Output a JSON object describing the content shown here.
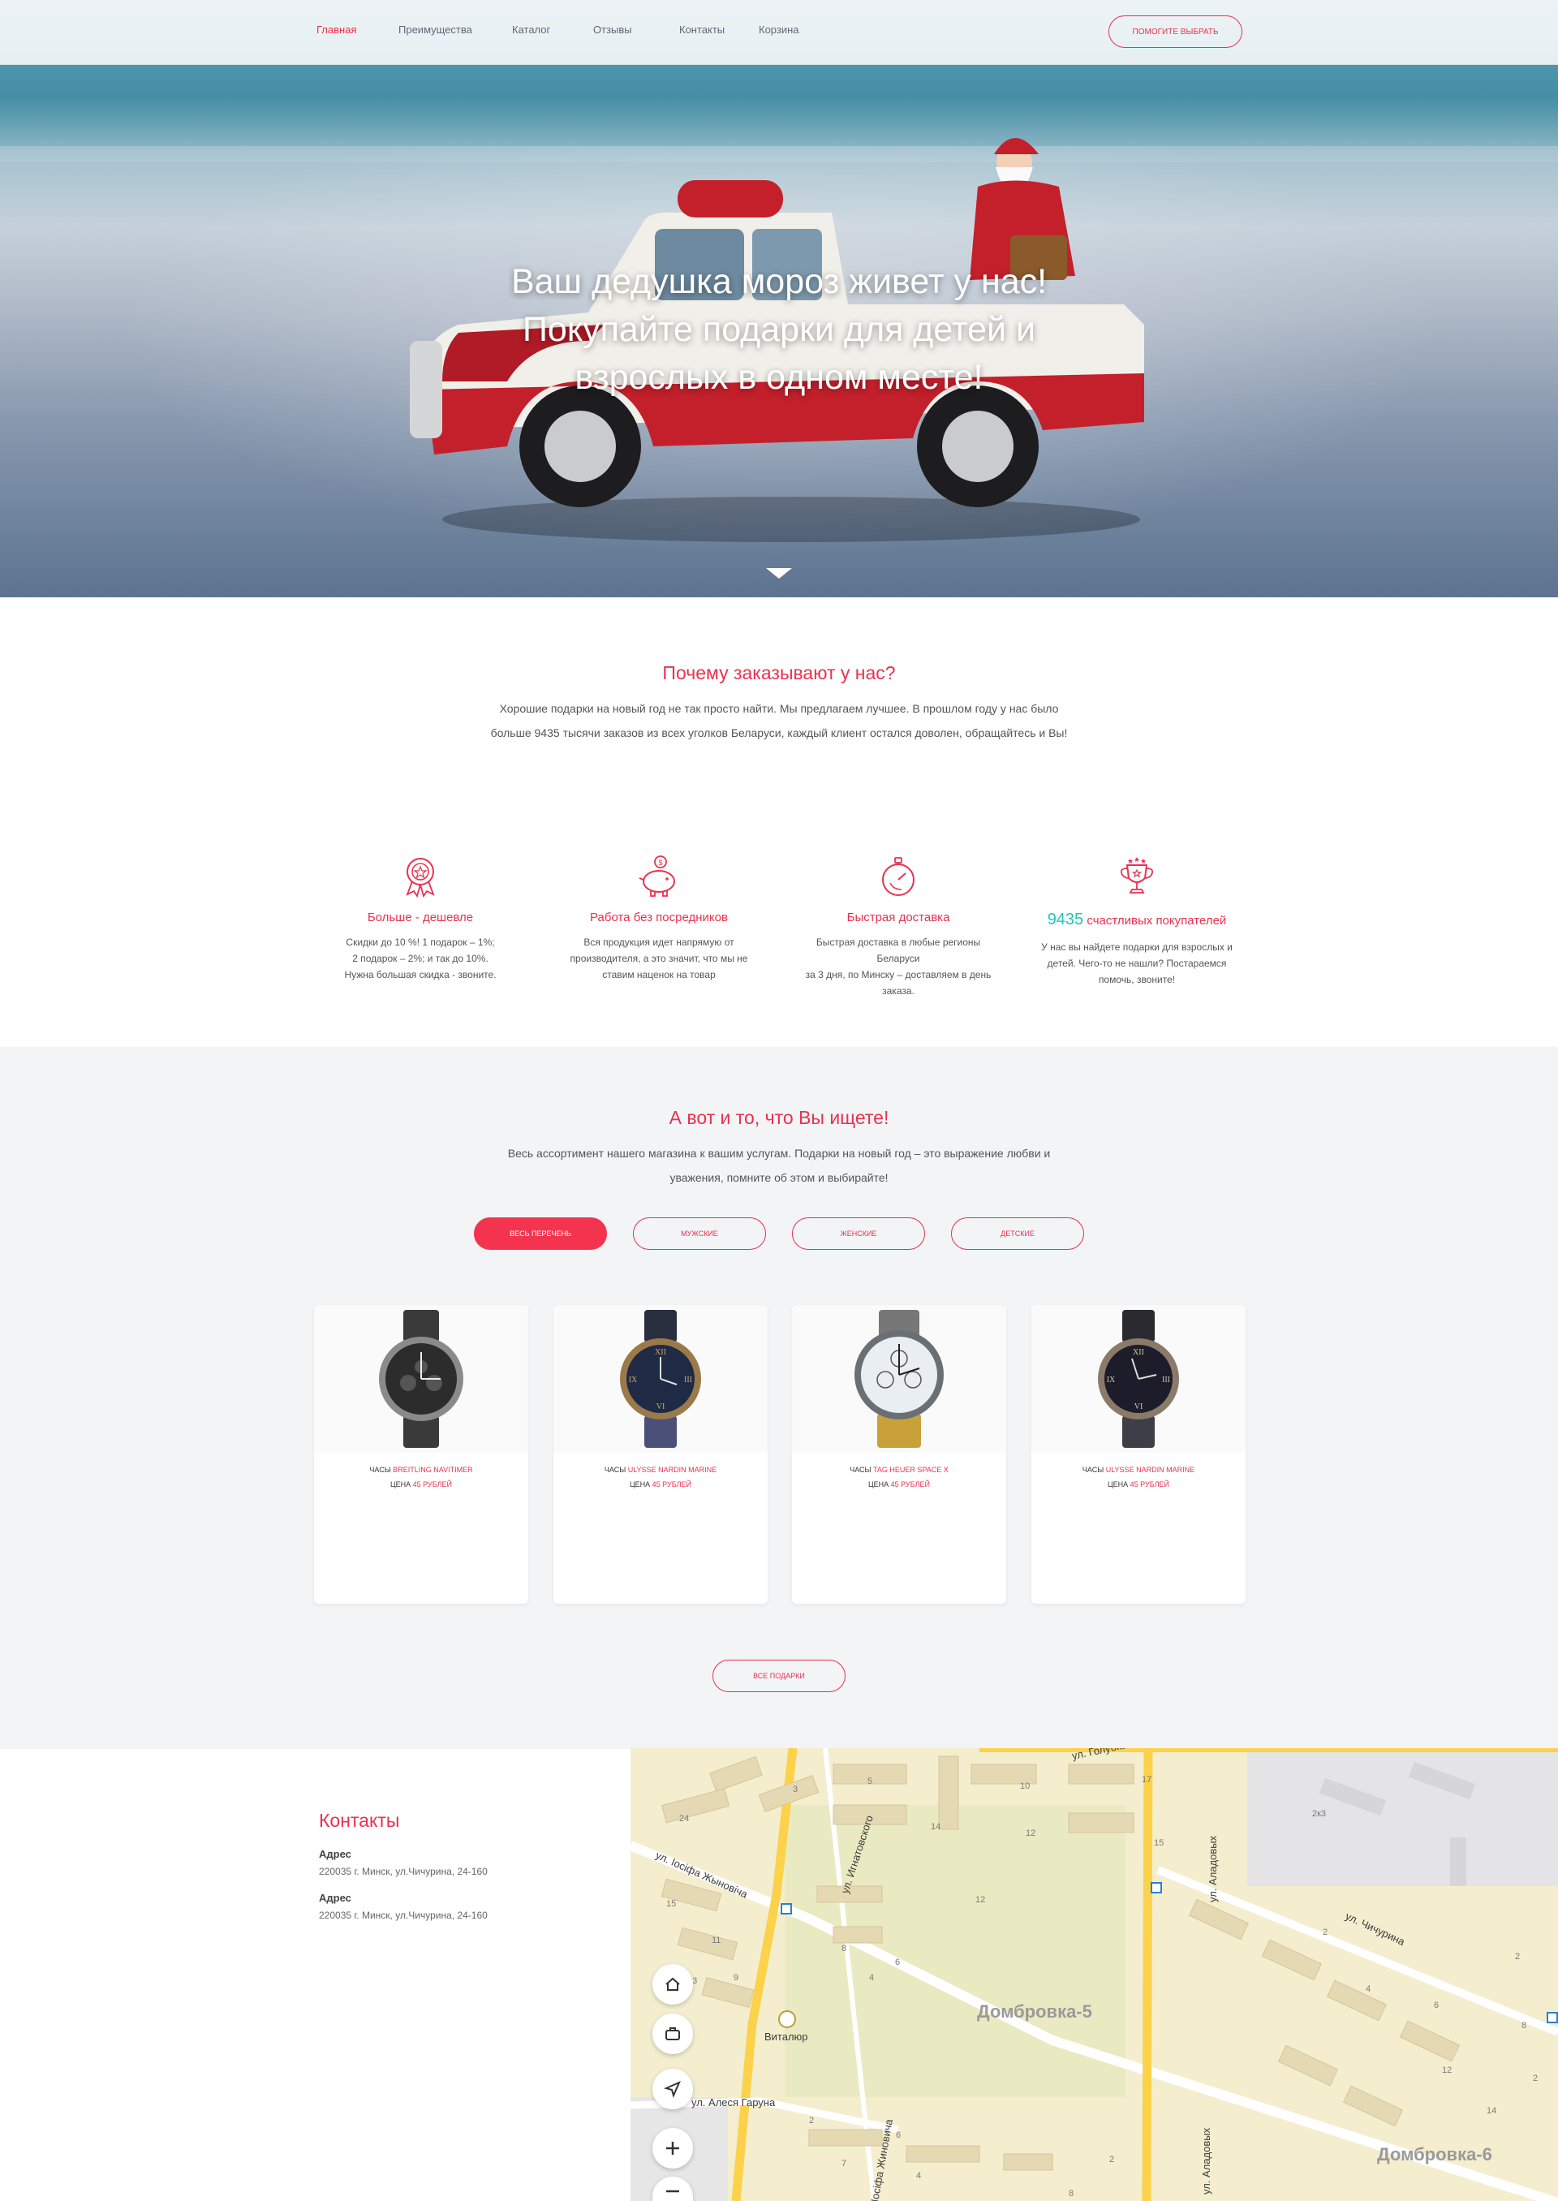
{
  "nav": {
    "items": [
      {
        "label": "Главная",
        "active": true
      },
      {
        "label": "Преимущества",
        "active": false
      },
      {
        "label": "Каталог",
        "active": false
      },
      {
        "label": "Отзывы",
        "active": false
      },
      {
        "label": "Контакты",
        "active": false
      },
      {
        "label": "Корзина",
        "active": false
      }
    ],
    "help_button": "ПОМОГИТЕ ВЫБРАТЬ"
  },
  "hero": {
    "title_lines": [
      "Ваш дедушка мороз живет у нас!",
      "Покупайте подарки для детей и",
      "взрослых в одном месте!"
    ]
  },
  "why": {
    "title": "Почему заказывают у нас?",
    "text_lines": [
      "Хорошие подарки на новый год не так просто найти. Мы предлагаем лучшее. В прошлом году у нас было",
      "больше 9435 тысячи заказов из всех уголков Беларуси, каждый клиент остался доволен, обращайтесь и Вы!"
    ],
    "features": [
      {
        "icon": "award-medal-icon",
        "title": "Больше - дешевле",
        "text_lines": [
          "Скидки до 10 %! 1 подарок – 1%;",
          "2 подарок – 2%; и так до 10%.",
          "Нужна большая скидка - звоните."
        ]
      },
      {
        "icon": "piggy-bank-icon",
        "title": "Работа без посредников",
        "text_lines": [
          "Вся продукция идет напрямую от",
          "производителя, а это значит, что мы не",
          "ставим наценок на товар"
        ]
      },
      {
        "icon": "stopwatch-icon",
        "title": "Быстрая доставка",
        "text_lines": [
          "Быстрая доставка в любые регионы Беларуси",
          "за 3 дня, по Минску – доставляем в день",
          "заказа."
        ]
      },
      {
        "icon": "trophy-cup-icon",
        "number": "9435",
        "title": "счастливых покупателей",
        "text_lines": [
          "У нас вы найдете подарки для взрослых и",
          "детей. Чего-то не нашли? Постараемся",
          "помочь, звоните!"
        ]
      }
    ],
    "accent_red": "#e8324f",
    "accent_teal": "#1ec7b8"
  },
  "catalog": {
    "title": "А вот и то, что Вы ищете!",
    "text_lines": [
      "Весь ассортимент нашего магазина к вашим услугам. Подарки на новый год – это выражение любви и",
      "уважения, помните об этом и выбирайте!"
    ],
    "filters": [
      {
        "label": "ВЕСЬ ПЕРЕЧЕНЬ",
        "active": true
      },
      {
        "label": "МУЖСКИЕ",
        "active": false
      },
      {
        "label": "ЖЕНСКИЕ",
        "active": false
      },
      {
        "label": "ДЕТСКИЕ",
        "active": false
      }
    ],
    "products": [
      {
        "prefix": "ЧАСЫ",
        "name": "BREITLING NAVITIMER",
        "price_label": "ЦЕНА",
        "price": "45 РУБЛЕЙ",
        "dial": "#2c2c2c",
        "strap": "#3a3a3a",
        "icon": "watch-icon"
      },
      {
        "prefix": "ЧАСЫ",
        "name": "ULYSSE NARDIN MARINE",
        "price_label": "ЦЕНА",
        "price": "45 РУБЛЕЙ",
        "dial": "#1f2a44",
        "strap": "#4a5078",
        "icon": "watch-icon"
      },
      {
        "prefix": "ЧАСЫ",
        "name": "TAG HEUER SPACE X",
        "price_label": "ЦЕНА",
        "price": "45 РУБЛЕЙ",
        "dial": "#e9eef2",
        "strap": "#c9a13a",
        "icon": "watch-icon"
      },
      {
        "prefix": "ЧАСЫ",
        "name": "ULYSSE NARDIN MARINE",
        "price_label": "ЦЕНА",
        "price": "45 РУБЛЕЙ",
        "dial": "#1c1c2a",
        "strap": "#3e3e48",
        "icon": "watch-icon"
      }
    ],
    "all_button": "ВСЕ ПОДАРКИ"
  },
  "contacts": {
    "title": "Контакты",
    "entries": [
      {
        "label": "Адрес",
        "value": "220035 г. Минск, ул.Чичурина, 24-160"
      },
      {
        "label": "Адрес",
        "value": "220035 г. Минск, ул.Чичурина, 24-160"
      }
    ]
  },
  "map": {
    "street_labels": [
      "ул. Голубка",
      "ул. Игнатовского",
      "ул. Іосіфа Жыновіча",
      "ул. Аладовых",
      "ул. Чичурина",
      "ул. Алеся Гаруна",
      "Іосіфа Жиновича",
      "ул. Аладовых"
    ],
    "district_labels": [
      "Домбровка-5",
      "Домбровка-6"
    ],
    "poi": "Виталюр",
    "house_numbers": [
      "3",
      "5",
      "24",
      "14",
      "12",
      "10",
      "17",
      "15",
      "2к3",
      "12",
      "15",
      "11",
      "8",
      "13",
      "9",
      "4",
      "6",
      "2",
      "4",
      "6",
      "2",
      "8",
      "12",
      "14",
      "2",
      "2",
      "7",
      "6",
      "4",
      "2",
      "8"
    ],
    "controls": [
      "home-icon",
      "briefcase-icon",
      "navigation-arrow-icon",
      "zoom-in-icon",
      "zoom-out-icon"
    ]
  }
}
